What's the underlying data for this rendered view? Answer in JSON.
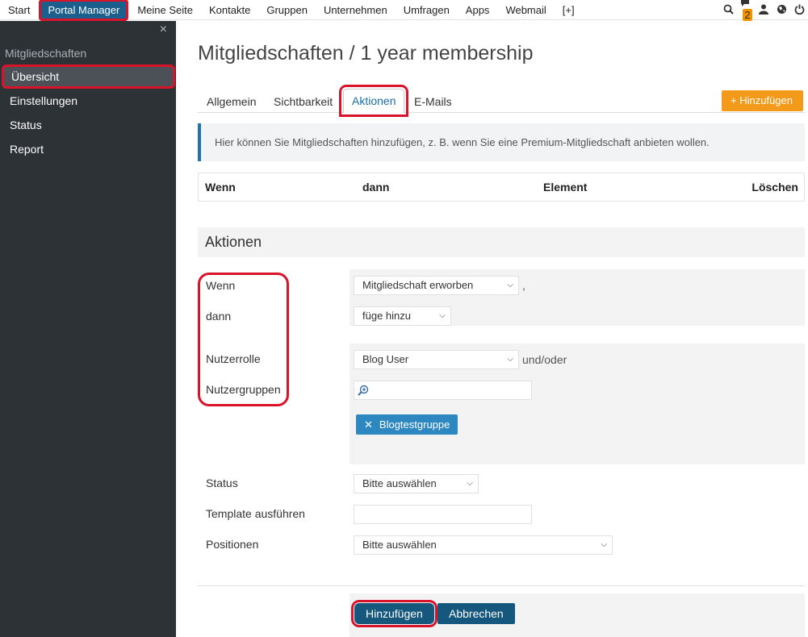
{
  "topnav": {
    "items": [
      "Start",
      "Portal Manager",
      "Meine Seite",
      "Kontakte",
      "Gruppen",
      "Unternehmen",
      "Umfragen",
      "Apps",
      "Webmail",
      "[+]"
    ],
    "notifications_count": "2",
    "icons": [
      "search-icon",
      "chat-icon",
      "user-icon",
      "globe-icon",
      "power-icon"
    ]
  },
  "sidebar": {
    "close": "×",
    "heading": "Mitgliedschaften",
    "items": [
      "Übersicht",
      "Einstellungen",
      "Status",
      "Report"
    ]
  },
  "main": {
    "title": "Mitgliedschaften / 1 year membership",
    "tabs": [
      "Allgemein",
      "Sichtbarkeit",
      "Aktionen",
      "E-Mails"
    ],
    "add_button": "+ Hinzufügen",
    "info": "Hier können Sie Mitgliedschaften hinzufügen, z. B. wenn Sie eine Premium-Mitgliedschaft anbieten wollen.",
    "table_headers": [
      "Wenn",
      "dann",
      "Element",
      "Löschen"
    ],
    "section_title": "Aktionen"
  },
  "form": {
    "labels": {
      "wenn": "Wenn",
      "dann": "dann",
      "nutzerrolle": "Nutzerrolle",
      "nutzergruppen": "Nutzergruppen",
      "status": "Status",
      "template": "Template ausführen",
      "positionen": "Positionen"
    },
    "wenn_value": "Mitgliedschaft erworben",
    "wenn_suffix": ",",
    "dann_value": "füge hinzu",
    "nutzerrolle_value": "Blog User",
    "nutzerrolle_suffix": "und/oder",
    "nutzergruppen_tag": "Blogtestgruppe",
    "status_value": "Bitte auswählen",
    "template_value": "",
    "positionen_value": "Bitte auswählen"
  },
  "footer": {
    "submit": "Hinzufügen",
    "cancel": "Abbrechen"
  },
  "colors": {
    "accent": "#1b5f8c",
    "orange": "#f49a1b",
    "highlight": "#d9142a",
    "tag": "#2d87c0"
  }
}
